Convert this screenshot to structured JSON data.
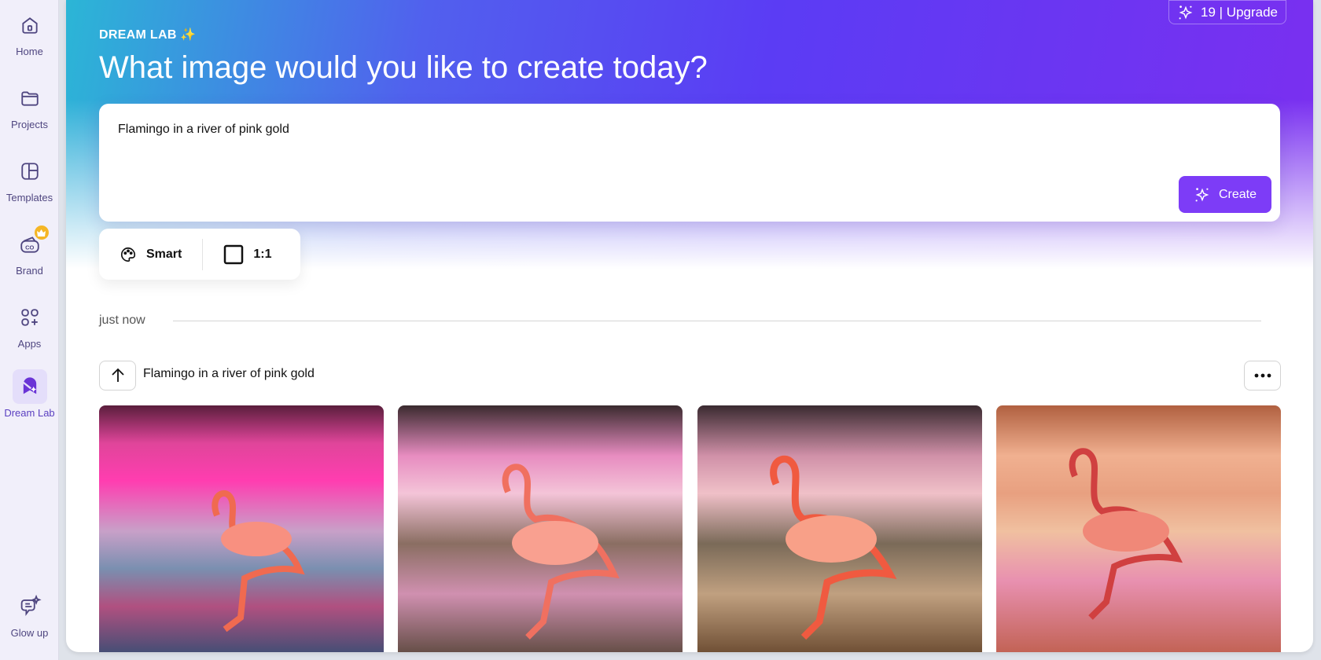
{
  "sidebar": {
    "items": [
      {
        "label": "Home",
        "icon": "home-icon"
      },
      {
        "label": "Projects",
        "icon": "folder-icon"
      },
      {
        "label": "Templates",
        "icon": "templates-icon"
      },
      {
        "label": "Brand",
        "icon": "brand-kit-icon",
        "badge": "crown-icon"
      },
      {
        "label": "Apps",
        "icon": "apps-icon"
      },
      {
        "label": "Dream Lab",
        "icon": "dream-lab-icon",
        "active": true
      },
      {
        "label": "Glow up",
        "icon": "glow-up-icon"
      }
    ]
  },
  "header": {
    "eyebrow": "DREAM LAB ✨",
    "title": "What image would you like to create today?",
    "credits": "19 | Upgrade"
  },
  "prompt": {
    "value": "Flamingo in a river of pink gold",
    "create_label": "Create"
  },
  "options": {
    "style": "Smart",
    "aspect_ratio": "1:1"
  },
  "history": {
    "group_label": "just now",
    "prompt": "Flamingo in a river of pink gold",
    "images": [
      {
        "alt": "Flamingo in vivid pink water"
      },
      {
        "alt": "Flamingo in shimmering pink water"
      },
      {
        "alt": "Flamingo in pink-gold water"
      },
      {
        "alt": "Flamingo in painted pink-gold swirls"
      }
    ]
  },
  "help_label": "?",
  "colors": {
    "accent": "#7d3cf7",
    "sidebar_bg": "#f1effa"
  }
}
